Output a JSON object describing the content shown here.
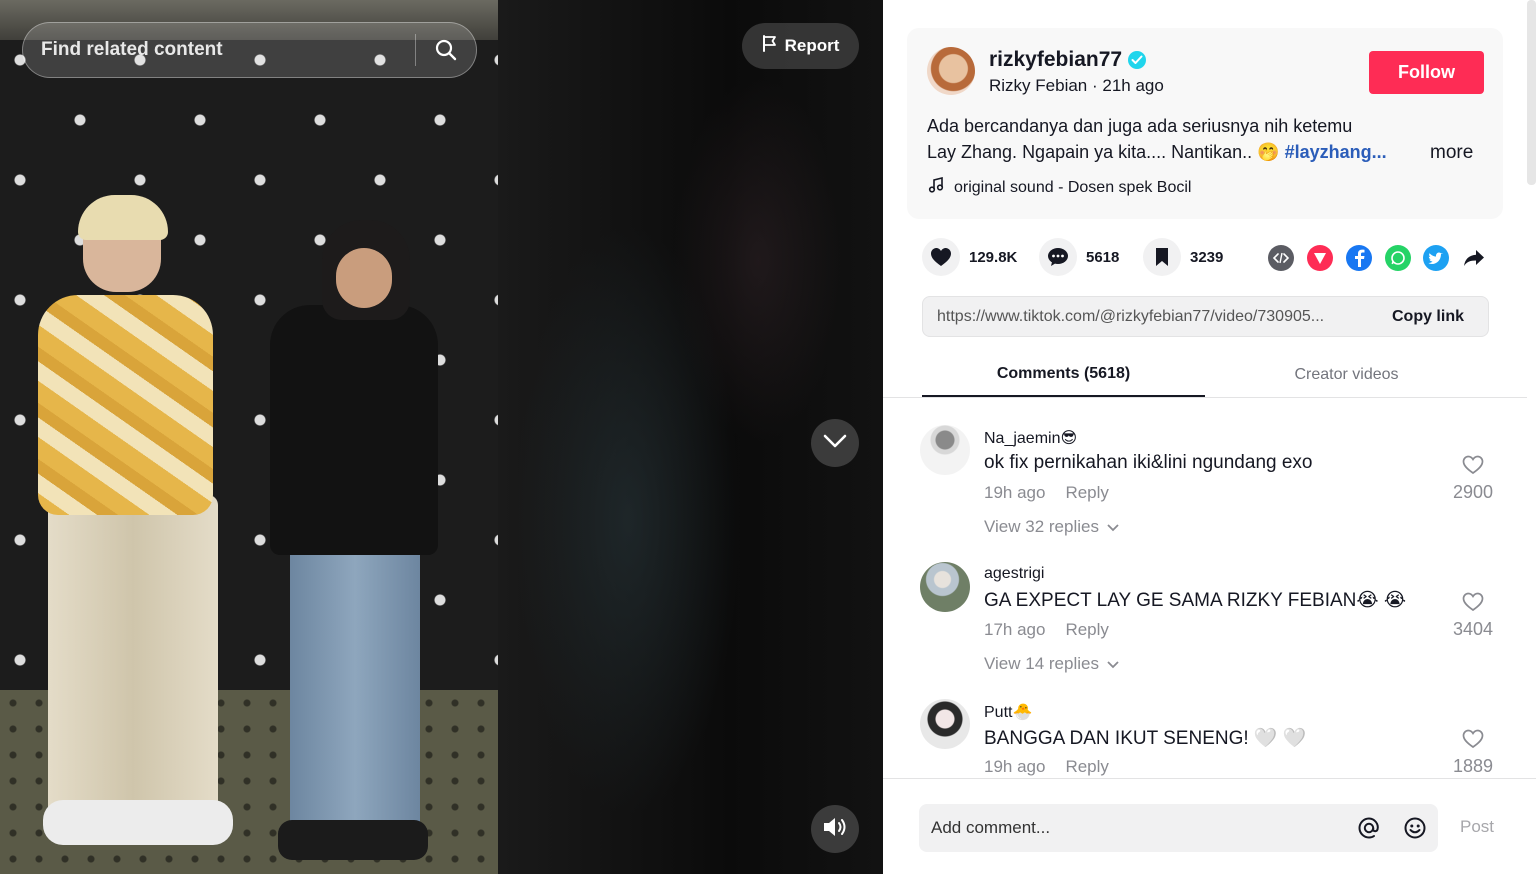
{
  "video": {
    "search_placeholder": "Find related content",
    "report_label": "Report"
  },
  "post": {
    "username": "rizkyfebian77",
    "display_name": "Rizky Febian",
    "time_ago": "21h ago",
    "follow_label": "Follow",
    "caption_line1": "Ada bercandanya dan juga ada seriusnya nih ketemu",
    "caption_line2": "Lay Zhang. Ngapain ya kita.... Nantikan.. 🤭",
    "hashtag": "#layzhang...",
    "more_label": "more",
    "sound": "original sound - Dosen spek Bocil"
  },
  "stats": {
    "likes": "129.8K",
    "comments": "5618",
    "saves": "3239"
  },
  "share": {
    "url": "https://www.tiktok.com/@rizkyfebian77/video/730905...",
    "copy_label": "Copy link",
    "icons": [
      "embed-icon",
      "send-icon",
      "facebook-icon",
      "whatsapp-icon",
      "twitter-icon",
      "share-arrow-icon"
    ]
  },
  "tabs": {
    "comments": "Comments (5618)",
    "creator": "Creator videos"
  },
  "comments": [
    {
      "name": "Na_jaemin😎",
      "text": "ok fix pernikahan iki&lini ngundang exo",
      "time": "19h ago",
      "reply": "Reply",
      "replies": "View 32 replies",
      "likes": "2900"
    },
    {
      "name": "agestrigi",
      "text": "GA EXPECT LAY GE SAMA RIZKY FEBIAN😭 😭",
      "time": "17h ago",
      "reply": "Reply",
      "replies": "View 14 replies",
      "likes": "3404"
    },
    {
      "name": "Putt🐣",
      "text": "BANGGA DAN IKUT SENENG! 🤍 🤍",
      "time": "19h ago",
      "reply": "Reply",
      "replies": "",
      "likes": "1889"
    }
  ],
  "composer": {
    "placeholder": "Add comment...",
    "post_label": "Post"
  },
  "colors": {
    "accent": "#fe2c55",
    "hashtag": "#2b5db9",
    "verified": "#20d5ec",
    "facebook": "#1877f2",
    "whatsapp": "#25d366",
    "twitter": "#1da1f2",
    "send": "#fe2c55"
  }
}
